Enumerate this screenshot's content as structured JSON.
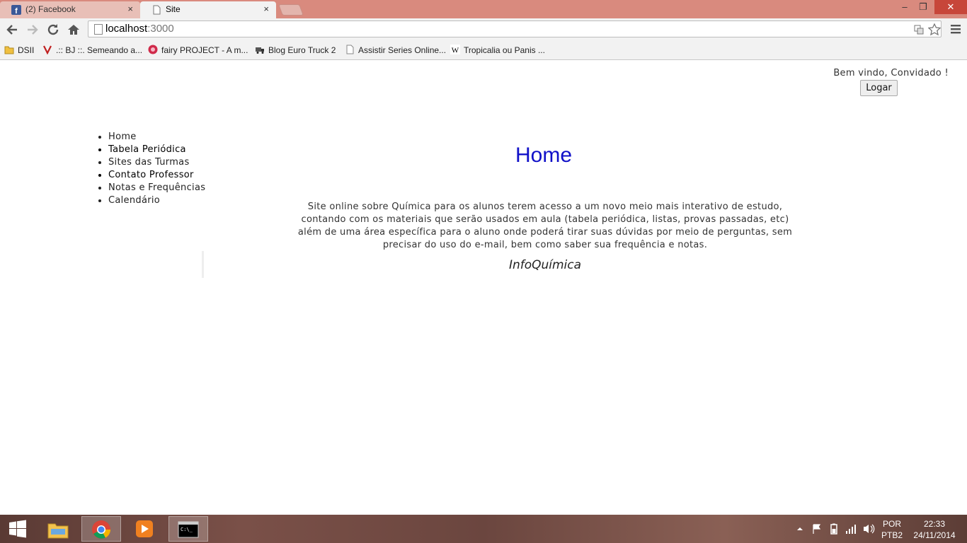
{
  "browser": {
    "tabs": [
      {
        "label": "(2) Facebook",
        "icon": "facebook-icon",
        "active": false
      },
      {
        "label": "Site",
        "icon": "page-icon",
        "active": true
      }
    ],
    "tab_close": "×",
    "window_controls": {
      "minimize": "–",
      "restore": "❐",
      "close": "✕"
    },
    "url": {
      "host": "localhost",
      "port": ":3000"
    },
    "bookmarks": [
      {
        "label": "DSII",
        "icon": "folder-icon"
      },
      {
        "label": ".:: BJ ::. Semeando a...",
        "icon": "bj-icon"
      },
      {
        "label": "fairy PROJECT - A m...",
        "icon": "fairy-icon"
      },
      {
        "label": "Blog Euro Truck 2",
        "icon": "truck-icon"
      },
      {
        "label": "Assistir Series Online...",
        "icon": "page-icon"
      },
      {
        "label": "Tropicalia ou Panis ...",
        "icon": "wikipedia-icon"
      }
    ]
  },
  "page": {
    "welcome": "Bem vindo, Convidado !",
    "login_button": "Logar",
    "nav": [
      "Home",
      "Tabela Periódica",
      "Sites das Turmas",
      "Contato Professor",
      "Notas e Frequências",
      "Calendário"
    ],
    "heading": "Home",
    "description": "Site online sobre Química para os alunos terem acesso a um novo meio mais interativo de estudo, contando com os materiais que serão usados em aula (tabela periódica, listas, provas passadas, etc) além de uma área específica para o aluno onde poderá tirar suas dúvidas por meio de perguntas, sem precisar do uso do e-mail, bem como saber sua frequência e notas.",
    "brand": "InfoQuímica",
    "heading_color": "#1010c8"
  },
  "taskbar": {
    "apps": [
      "start-icon",
      "file-explorer-icon",
      "chrome-icon",
      "media-player-icon",
      "command-prompt-icon"
    ],
    "language": "POR",
    "keyboard": "PTB2",
    "time": "22:33",
    "date": "24/11/2014"
  }
}
